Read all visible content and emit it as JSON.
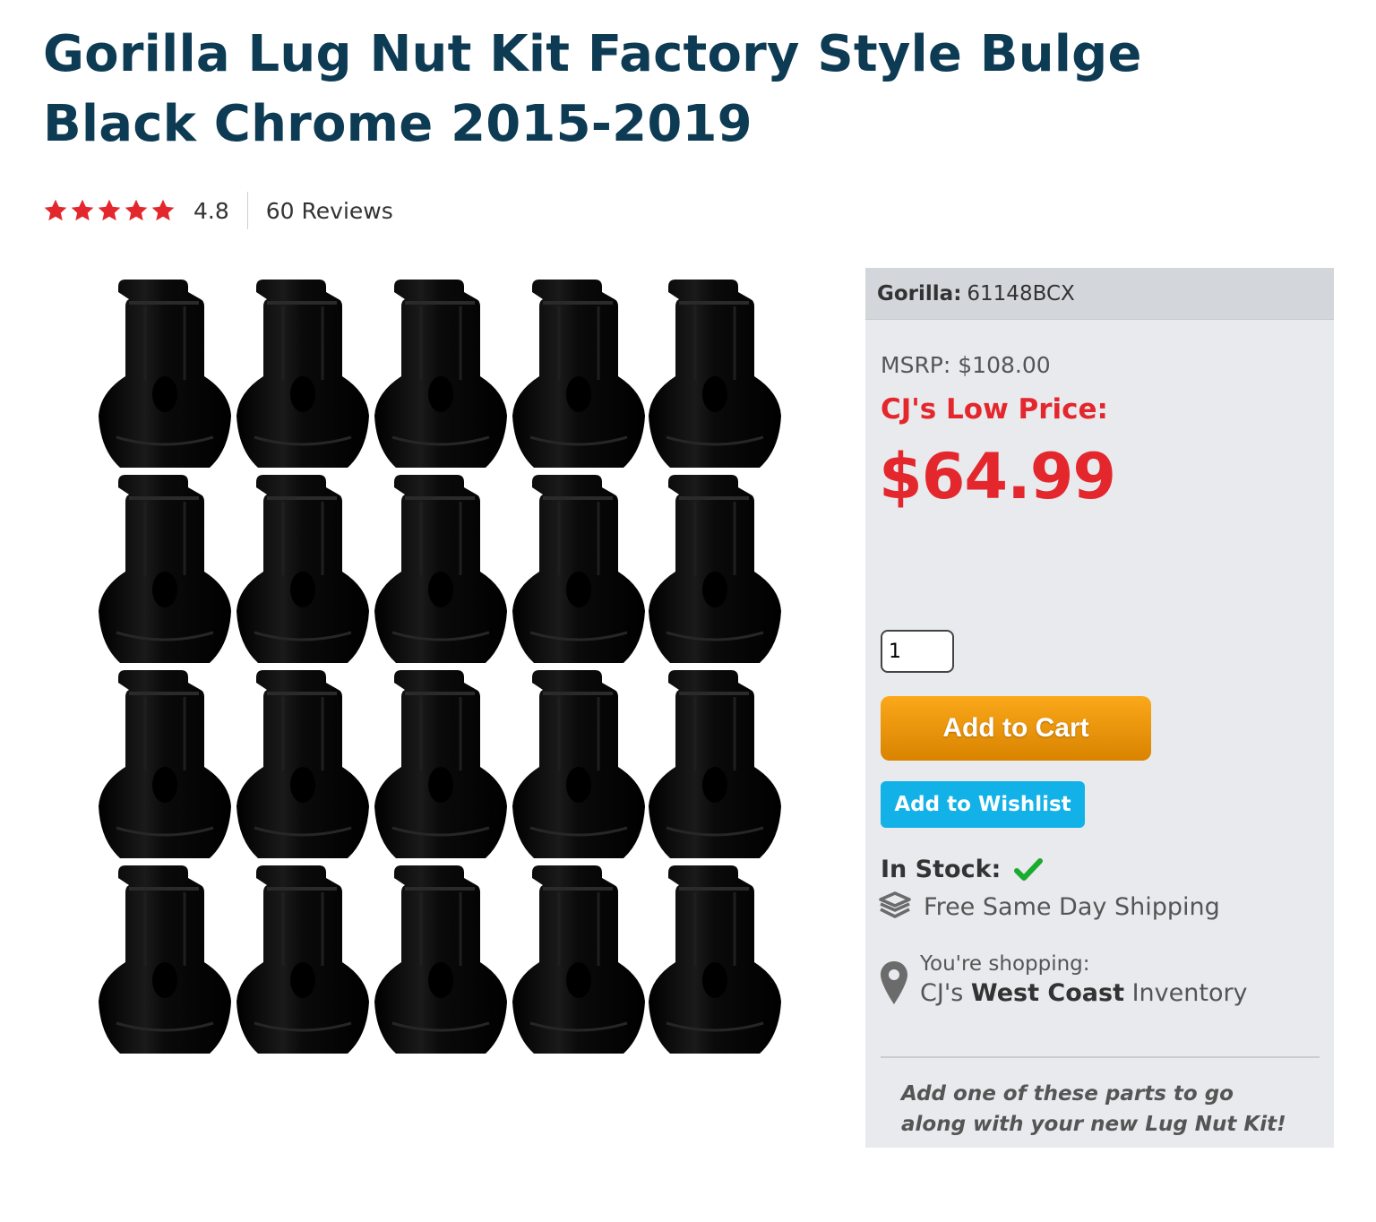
{
  "product": {
    "title": "Gorilla Lug Nut Kit Factory Style Bulge Black Chrome 2015-2019",
    "rating": {
      "stars": 5,
      "value": "4.8",
      "reviews_label": "60 Reviews"
    },
    "image": {
      "nut_rows": 4,
      "nut_columns": 5,
      "icon": "lug-nut-grid"
    }
  },
  "buy_box": {
    "brand_label": "Gorilla:",
    "part_number": "61148BCX",
    "msrp": "MSRP: $108.00",
    "low_price_label": "CJ's Low Price:",
    "price": "$64.99",
    "quantity": "1",
    "add_to_cart": "Add to Cart",
    "add_to_wishlist": "Add to Wishlist",
    "stock_label": "In Stock:",
    "shipping": "Free Same Day Shipping",
    "shopping_label": "You're shopping:",
    "inventory_prefix": "CJ's",
    "inventory_bold": "West Coast",
    "inventory_suffix": "Inventory",
    "addon_text": "Add one of these parts to go along with your new Lug Nut Kit!"
  },
  "colors": {
    "title": "#0d3b54",
    "star": "#e3272d",
    "price": "#e3272d",
    "cart_button": "#f39c12",
    "wishlist_button": "#12b1e8",
    "check": "#1aab2f",
    "panel": "#e8eaed"
  }
}
